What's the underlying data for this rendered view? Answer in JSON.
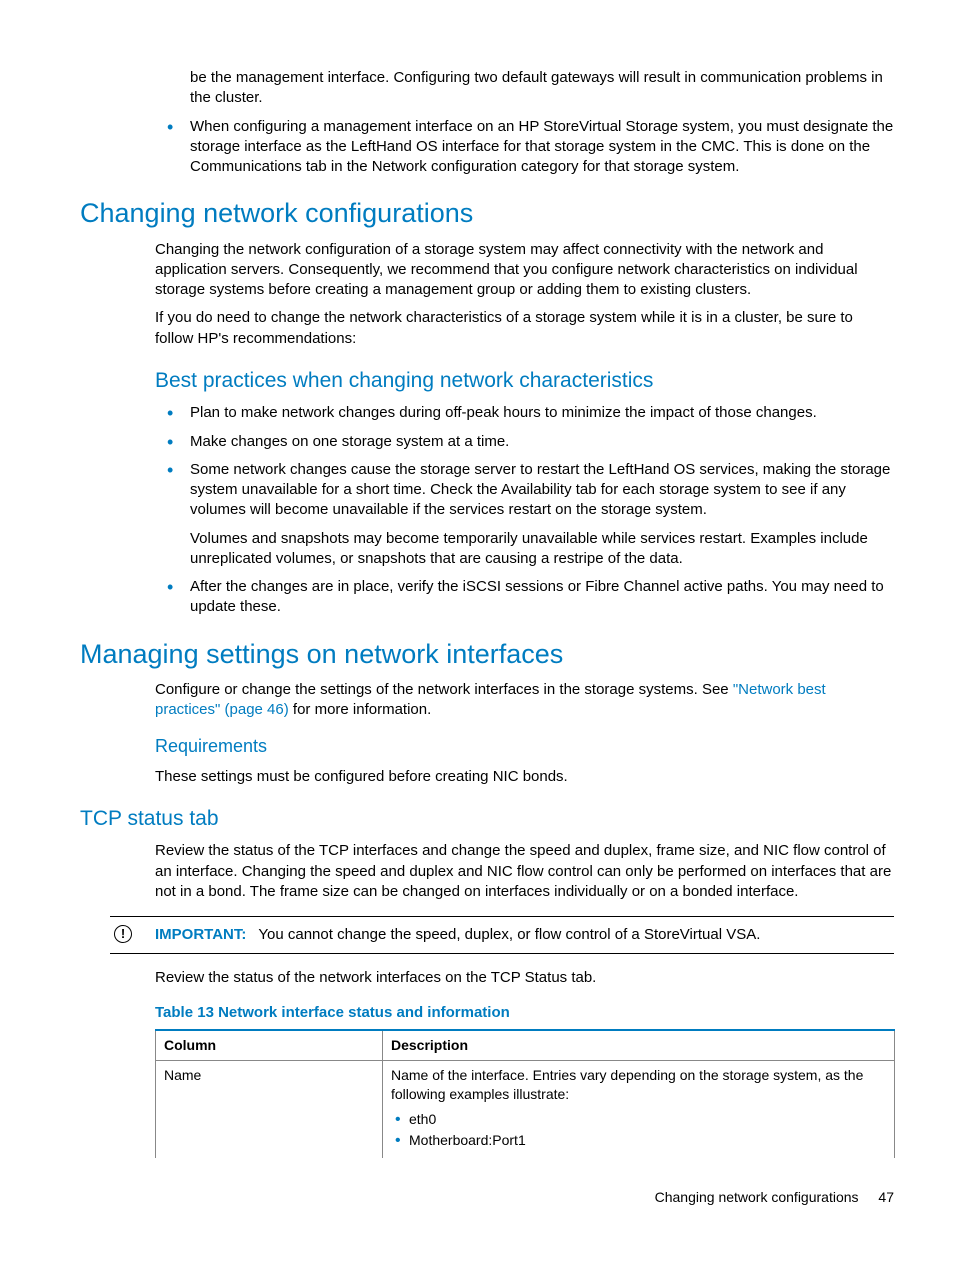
{
  "top": {
    "continued_para": "be the management interface. Configuring two default gateways will result in communication problems in the cluster.",
    "bullet_mgmt": "When configuring a management interface on an HP StoreVirtual Storage system, you must designate the storage interface as the LeftHand OS interface for that storage system in the CMC. This is done on the Communications tab in the Network configuration category for that storage system."
  },
  "changing": {
    "heading": "Changing network configurations",
    "p1": "Changing the network configuration of a storage system may affect connectivity with the network and application servers. Consequently, we recommend that you configure network characteristics on individual storage systems before creating a management group or adding them to existing clusters.",
    "p2": "If you do need to change the network characteristics of a storage system while it is in a cluster, be sure to follow HP's recommendations:",
    "best_heading": "Best practices when changing network characteristics",
    "bp1": "Plan to make network changes during off-peak hours to minimize the impact of those changes.",
    "bp2": "Make changes on one storage system at a time.",
    "bp3": "Some network changes cause the storage server to restart the LeftHand OS services, making the storage system unavailable for a short time. Check the Availability tab for each storage system to see if any volumes will become unavailable if the services restart on the storage system.",
    "bp3b": "Volumes and snapshots may become temporarily unavailable while services restart. Examples include unreplicated volumes, or snapshots that are causing a restripe of the data.",
    "bp4": "After the changes are in place, verify the iSCSI sessions or Fibre Channel active paths. You may need to update these."
  },
  "managing": {
    "heading": "Managing settings on network interfaces",
    "p1_a": "Configure or change the settings of the network interfaces in the storage systems. See ",
    "p1_link": "\"Network best practices\" (page 46)",
    "p1_b": " for more information.",
    "req_heading": "Requirements",
    "req_p": "These settings must be configured before creating NIC bonds."
  },
  "tcp": {
    "heading": "TCP status tab",
    "p1": "Review the status of the TCP interfaces and change the speed and duplex, frame size, and NIC flow control of an interface. Changing the speed and duplex and NIC flow control can only be performed on interfaces that are not in a bond. The frame size can be changed on interfaces individually or on a bonded interface.",
    "important_label": "IMPORTANT:",
    "important_text": "You cannot change the speed, duplex, or flow control of a StoreVirtual VSA.",
    "p2": "Review the status of the network interfaces on the TCP Status tab.",
    "table_title": "Table 13 Network interface status and information",
    "th_col": "Column",
    "th_desc": "Description",
    "row1_col": "Name",
    "row1_desc": "Name of the interface. Entries vary depending on the storage system, as the following examples illustrate:",
    "row1_li1": "eth0",
    "row1_li2": "Motherboard:Port1"
  },
  "footer": {
    "text": "Changing network configurations",
    "page": "47"
  }
}
